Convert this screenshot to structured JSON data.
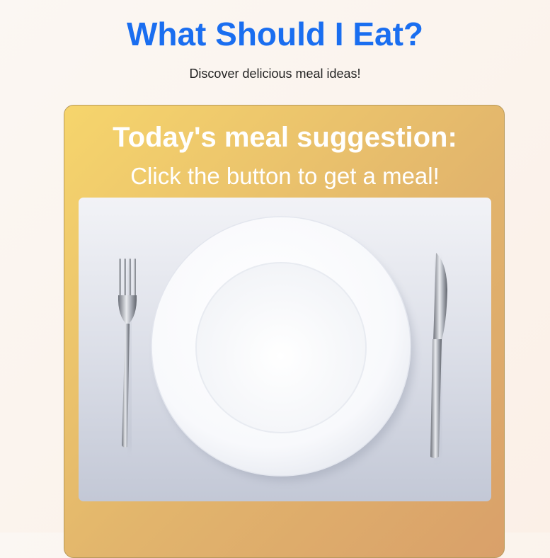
{
  "header": {
    "title": "What Should I Eat?",
    "subtitle": "Discover delicious meal ideas!"
  },
  "card": {
    "heading": "Today's meal suggestion:",
    "meal": "Click the button to get a meal!",
    "image_alt": "empty-plate-with-fork-and-knife"
  },
  "colors": {
    "title": "#1a6ef0",
    "card_gradient_start": "#f6d56c",
    "card_gradient_end": "#d9a06a",
    "card_text": "#ffffff"
  }
}
